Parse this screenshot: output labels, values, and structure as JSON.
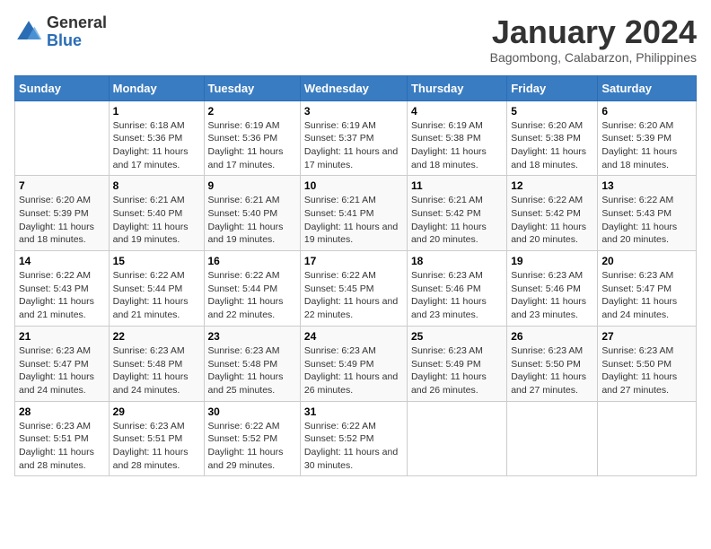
{
  "header": {
    "logo_general": "General",
    "logo_blue": "Blue",
    "month_title": "January 2024",
    "location": "Bagombong, Calabarzon, Philippines"
  },
  "days_of_week": [
    "Sunday",
    "Monday",
    "Tuesday",
    "Wednesday",
    "Thursday",
    "Friday",
    "Saturday"
  ],
  "weeks": [
    [
      {
        "num": "",
        "sunrise": "",
        "sunset": "",
        "daylight": ""
      },
      {
        "num": "1",
        "sunrise": "Sunrise: 6:18 AM",
        "sunset": "Sunset: 5:36 PM",
        "daylight": "Daylight: 11 hours and 17 minutes."
      },
      {
        "num": "2",
        "sunrise": "Sunrise: 6:19 AM",
        "sunset": "Sunset: 5:36 PM",
        "daylight": "Daylight: 11 hours and 17 minutes."
      },
      {
        "num": "3",
        "sunrise": "Sunrise: 6:19 AM",
        "sunset": "Sunset: 5:37 PM",
        "daylight": "Daylight: 11 hours and 17 minutes."
      },
      {
        "num": "4",
        "sunrise": "Sunrise: 6:19 AM",
        "sunset": "Sunset: 5:38 PM",
        "daylight": "Daylight: 11 hours and 18 minutes."
      },
      {
        "num": "5",
        "sunrise": "Sunrise: 6:20 AM",
        "sunset": "Sunset: 5:38 PM",
        "daylight": "Daylight: 11 hours and 18 minutes."
      },
      {
        "num": "6",
        "sunrise": "Sunrise: 6:20 AM",
        "sunset": "Sunset: 5:39 PM",
        "daylight": "Daylight: 11 hours and 18 minutes."
      }
    ],
    [
      {
        "num": "7",
        "sunrise": "Sunrise: 6:20 AM",
        "sunset": "Sunset: 5:39 PM",
        "daylight": "Daylight: 11 hours and 18 minutes."
      },
      {
        "num": "8",
        "sunrise": "Sunrise: 6:21 AM",
        "sunset": "Sunset: 5:40 PM",
        "daylight": "Daylight: 11 hours and 19 minutes."
      },
      {
        "num": "9",
        "sunrise": "Sunrise: 6:21 AM",
        "sunset": "Sunset: 5:40 PM",
        "daylight": "Daylight: 11 hours and 19 minutes."
      },
      {
        "num": "10",
        "sunrise": "Sunrise: 6:21 AM",
        "sunset": "Sunset: 5:41 PM",
        "daylight": "Daylight: 11 hours and 19 minutes."
      },
      {
        "num": "11",
        "sunrise": "Sunrise: 6:21 AM",
        "sunset": "Sunset: 5:42 PM",
        "daylight": "Daylight: 11 hours and 20 minutes."
      },
      {
        "num": "12",
        "sunrise": "Sunrise: 6:22 AM",
        "sunset": "Sunset: 5:42 PM",
        "daylight": "Daylight: 11 hours and 20 minutes."
      },
      {
        "num": "13",
        "sunrise": "Sunrise: 6:22 AM",
        "sunset": "Sunset: 5:43 PM",
        "daylight": "Daylight: 11 hours and 20 minutes."
      }
    ],
    [
      {
        "num": "14",
        "sunrise": "Sunrise: 6:22 AM",
        "sunset": "Sunset: 5:43 PM",
        "daylight": "Daylight: 11 hours and 21 minutes."
      },
      {
        "num": "15",
        "sunrise": "Sunrise: 6:22 AM",
        "sunset": "Sunset: 5:44 PM",
        "daylight": "Daylight: 11 hours and 21 minutes."
      },
      {
        "num": "16",
        "sunrise": "Sunrise: 6:22 AM",
        "sunset": "Sunset: 5:44 PM",
        "daylight": "Daylight: 11 hours and 22 minutes."
      },
      {
        "num": "17",
        "sunrise": "Sunrise: 6:22 AM",
        "sunset": "Sunset: 5:45 PM",
        "daylight": "Daylight: 11 hours and 22 minutes."
      },
      {
        "num": "18",
        "sunrise": "Sunrise: 6:23 AM",
        "sunset": "Sunset: 5:46 PM",
        "daylight": "Daylight: 11 hours and 23 minutes."
      },
      {
        "num": "19",
        "sunrise": "Sunrise: 6:23 AM",
        "sunset": "Sunset: 5:46 PM",
        "daylight": "Daylight: 11 hours and 23 minutes."
      },
      {
        "num": "20",
        "sunrise": "Sunrise: 6:23 AM",
        "sunset": "Sunset: 5:47 PM",
        "daylight": "Daylight: 11 hours and 24 minutes."
      }
    ],
    [
      {
        "num": "21",
        "sunrise": "Sunrise: 6:23 AM",
        "sunset": "Sunset: 5:47 PM",
        "daylight": "Daylight: 11 hours and 24 minutes."
      },
      {
        "num": "22",
        "sunrise": "Sunrise: 6:23 AM",
        "sunset": "Sunset: 5:48 PM",
        "daylight": "Daylight: 11 hours and 24 minutes."
      },
      {
        "num": "23",
        "sunrise": "Sunrise: 6:23 AM",
        "sunset": "Sunset: 5:48 PM",
        "daylight": "Daylight: 11 hours and 25 minutes."
      },
      {
        "num": "24",
        "sunrise": "Sunrise: 6:23 AM",
        "sunset": "Sunset: 5:49 PM",
        "daylight": "Daylight: 11 hours and 26 minutes."
      },
      {
        "num": "25",
        "sunrise": "Sunrise: 6:23 AM",
        "sunset": "Sunset: 5:49 PM",
        "daylight": "Daylight: 11 hours and 26 minutes."
      },
      {
        "num": "26",
        "sunrise": "Sunrise: 6:23 AM",
        "sunset": "Sunset: 5:50 PM",
        "daylight": "Daylight: 11 hours and 27 minutes."
      },
      {
        "num": "27",
        "sunrise": "Sunrise: 6:23 AM",
        "sunset": "Sunset: 5:50 PM",
        "daylight": "Daylight: 11 hours and 27 minutes."
      }
    ],
    [
      {
        "num": "28",
        "sunrise": "Sunrise: 6:23 AM",
        "sunset": "Sunset: 5:51 PM",
        "daylight": "Daylight: 11 hours and 28 minutes."
      },
      {
        "num": "29",
        "sunrise": "Sunrise: 6:23 AM",
        "sunset": "Sunset: 5:51 PM",
        "daylight": "Daylight: 11 hours and 28 minutes."
      },
      {
        "num": "30",
        "sunrise": "Sunrise: 6:22 AM",
        "sunset": "Sunset: 5:52 PM",
        "daylight": "Daylight: 11 hours and 29 minutes."
      },
      {
        "num": "31",
        "sunrise": "Sunrise: 6:22 AM",
        "sunset": "Sunset: 5:52 PM",
        "daylight": "Daylight: 11 hours and 30 minutes."
      },
      {
        "num": "",
        "sunrise": "",
        "sunset": "",
        "daylight": ""
      },
      {
        "num": "",
        "sunrise": "",
        "sunset": "",
        "daylight": ""
      },
      {
        "num": "",
        "sunrise": "",
        "sunset": "",
        "daylight": ""
      }
    ]
  ]
}
